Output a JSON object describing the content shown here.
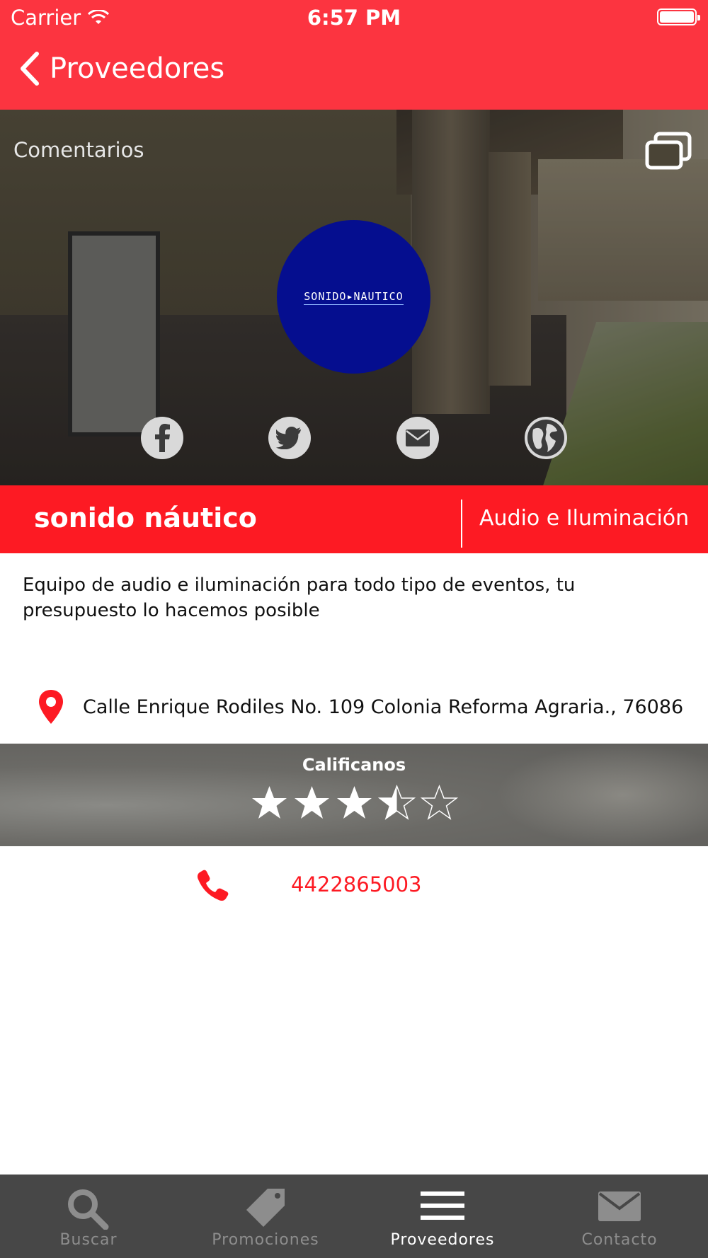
{
  "status_bar": {
    "carrier": "Carrier",
    "time": "6:57 PM"
  },
  "nav": {
    "back_label": "Proveedores",
    "back_icon": "chevron-left-icon"
  },
  "hero": {
    "comments_label": "Comentarios",
    "logo_text": "SONIDO▸NAUTICO",
    "logo_color": "#050e8f",
    "social": [
      "facebook-icon",
      "twitter-icon",
      "mail-icon",
      "globe-icon"
    ]
  },
  "provider": {
    "name": "sonido náutico",
    "category": "Audio e Iluminación",
    "description": "Equipo de audio e iluminación para todo tipo de eventos, tu presupuesto lo hacemos posible",
    "address": "Calle Enrique Rodiles No. 109 Colonia Reforma Agraria., 76086",
    "phone": "4422865003"
  },
  "rating": {
    "title": "Calificanos",
    "value": 3.5,
    "max": 5
  },
  "tabs": [
    {
      "label": "Buscar",
      "icon": "search-icon",
      "active": false
    },
    {
      "label": "Promociones",
      "icon": "tag-icon",
      "active": false
    },
    {
      "label": "Proveedores",
      "icon": "menu-icon",
      "active": true
    },
    {
      "label": "Contacto",
      "icon": "envelope-icon",
      "active": false
    }
  ],
  "colors": {
    "primary": "#fc3440",
    "title_bar": "#fd1a23",
    "tab_bar": "#474747"
  }
}
